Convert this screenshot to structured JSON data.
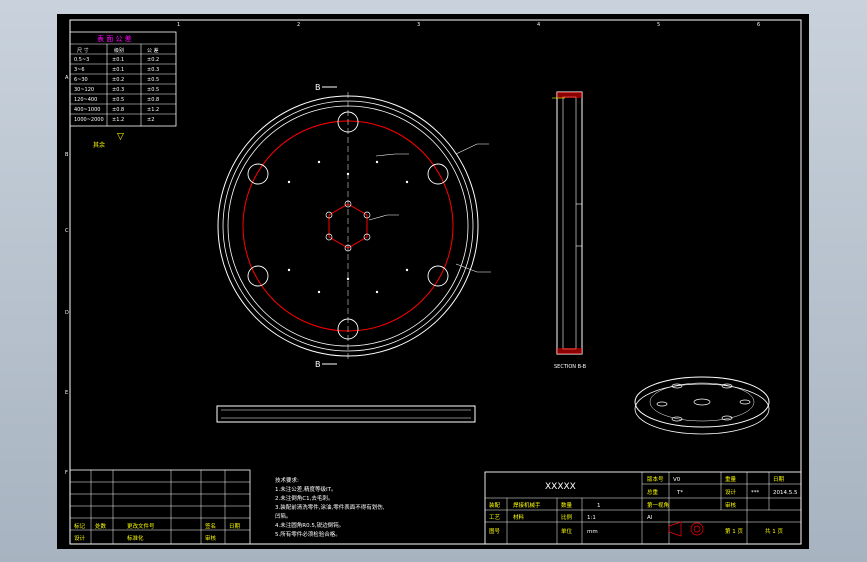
{
  "rough_table": {
    "title": "表 面 公 差",
    "headers": [
      "尺 寸",
      "级别",
      "公 差"
    ],
    "rows": [
      [
        "0.5~3",
        "±0.1",
        "±0.2"
      ],
      [
        "3~6",
        "±0.1",
        "±0.3"
      ],
      [
        "6~30",
        "±0.2",
        "±0.5"
      ],
      [
        "30~120",
        "±0.3",
        "±0.5"
      ],
      [
        "120~400",
        "±0.5",
        "±0.8"
      ],
      [
        "400~1000",
        "±0.8",
        "±1.2"
      ],
      [
        "1000~2000",
        "±1.2",
        "±2"
      ]
    ],
    "roughness_label": "其余",
    "roughness_symbol": "▽"
  },
  "section_labels": {
    "top": "B",
    "bottom": "B"
  },
  "section_view_label": "SECTION B-B",
  "tech_requirements": [
    "技术要求:",
    "1.未注公差,精度等级IT。",
    "2.未注倒角C1,去毛刺。",
    "3.装配前清洗零件,涂油,零件表面不得有划伤,",
    "  凹陷。",
    "4.未注圆角R0.5,锐边倒钝。",
    "5.所有零件必须检验合格。"
  ],
  "revision_block": {
    "labels": [
      "标记",
      "处数",
      "更改文件号",
      "签名",
      "日期"
    ],
    "labels_row2": [
      "设计",
      "",
      "标准化",
      "",
      "审核"
    ]
  },
  "title_block": {
    "project": "XXXXX",
    "version_label": "版本号",
    "version": "V0",
    "weight_label": "重量",
    "date_label": "日期",
    "total_weight_label": "总重",
    "total_weight": "T*",
    "designer_label": "设计",
    "designer": "***",
    "date": "2014.5.5",
    "assembly_label": "装配",
    "assembly": "焊接机械手",
    "count_label": "数量",
    "count": "1",
    "projection_label": "第一视角",
    "process_label": "工艺",
    "material_label": "材料",
    "material": "Al",
    "scale_label": "比例",
    "scale": "1:1",
    "drawing_no_label": "图号",
    "unit_label": "单位",
    "unit": "mm",
    "sheet_label": "第 1 页",
    "sheet_total": "共 1 页",
    "check_label": "审核"
  },
  "colors": {
    "background": "#000000",
    "line": "#ffffff",
    "hidden": "#ff0000",
    "text": "#ffff00",
    "accent": "#ff00ff"
  }
}
